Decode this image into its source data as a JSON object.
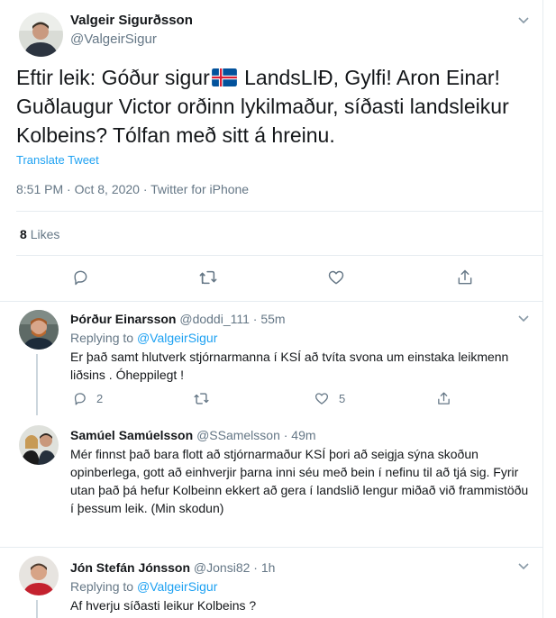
{
  "main": {
    "name": "Valgeir Sigurðsson",
    "handle": "@ValgeirSigur",
    "text_before_flag": "Eftir leik: Góður sigur",
    "text_after_flag": " LandsLIÐ, Gylfi! Aron Einar! Guðlaugur Victor orðinn lykilmaður, síðasti landsleikur Kolbeins? Tólfan með sitt á hreinu.",
    "translate": "Translate Tweet",
    "timestamp": "8:51 PM · Oct 8, 2020 · Twitter for iPhone",
    "likes_count": "8",
    "likes_label": "Likes"
  },
  "replies": [
    {
      "name": "Þórður Einarsson",
      "handle": "@doddi_111 · 55m",
      "replying_prefix": "Replying to ",
      "replying_to": "@ValgeirSigur",
      "text": "Er það samt hlutverk stjórnarmanna í KSÍ að tvíta svona um einstaka leikmenn liðsins . Óheppilegt !",
      "reply_count": "2",
      "retweet_count": "",
      "like_count": "5"
    },
    {
      "name": "Samúel Samúelsson",
      "handle": "@SSamelsson · 49m",
      "text": "Mér finnst það bara flott að stjórnarmaður KSÍ þori að seigja sýna skoðun opinberlega, gott að einhverjir þarna inni séu með bein í nefinu til að tjá sig. Fyrir utan það þá hefur Kolbeinn ekkert að gera í landslið lengur miðað við frammistöðu í þessum leik.  (Min skodun)"
    },
    {
      "name": "Jón Stefán Jónsson",
      "handle": "@Jonsi82 · 1h",
      "replying_prefix": "Replying to ",
      "replying_to": "@ValgeirSigur",
      "text": "Af hverju síðasti leikur Kolbeins ?"
    }
  ],
  "colors": {
    "accent": "#1da1f2",
    "secondary_text": "#657786",
    "divider": "#e6ecf0",
    "flag_blue": "#02529c",
    "flag_red": "#dc1e35"
  }
}
